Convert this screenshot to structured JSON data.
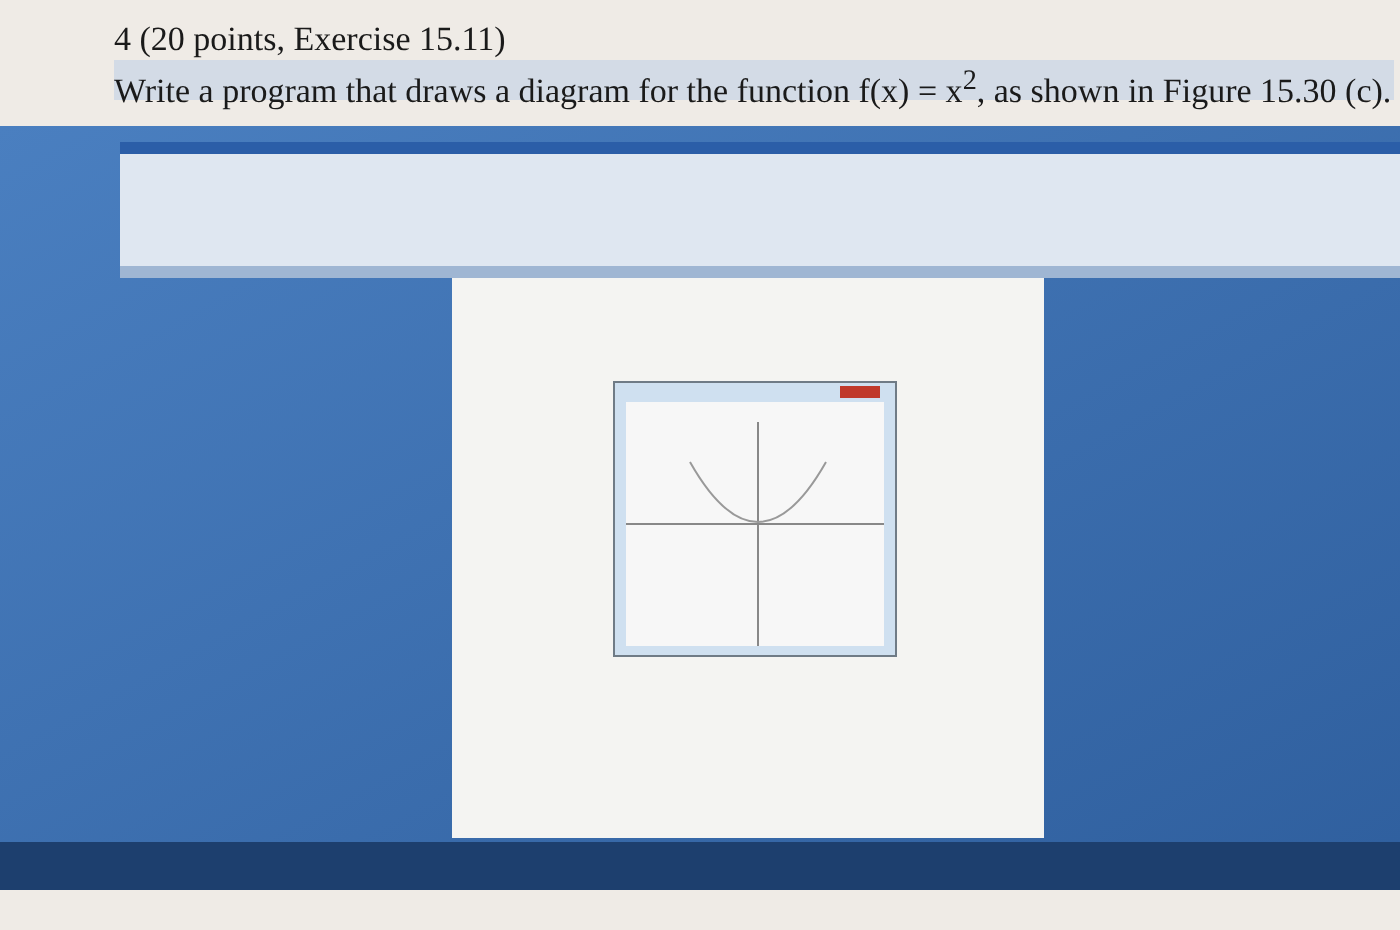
{
  "question": {
    "heading": "4 (20 points, Exercise 15.11)",
    "body": "Write a program that draws a diagram for the function f(x) = x$^{2}$, as shown in Figure 15.30 (c)."
  }
}
